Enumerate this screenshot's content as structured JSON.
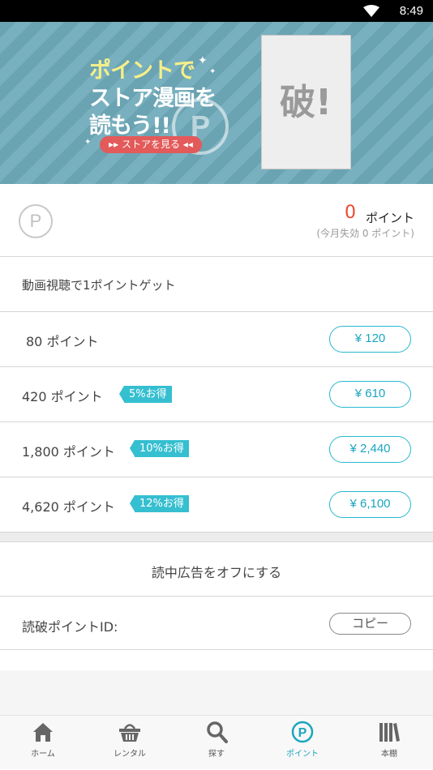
{
  "status_bar": {
    "time": "8:49"
  },
  "banner": {
    "line1": "ポイントで",
    "line2": "ストア漫画を",
    "line3": "読もう!!",
    "p_mark": "P",
    "store_button": "▸▸ ストアを見る ◂◂",
    "book_logo": "破!"
  },
  "points": {
    "logo": "P",
    "count": "0",
    "unit": "ポイント",
    "expire_note": "(今月失効 0 ポイント)"
  },
  "video_reward": {
    "label": "動画視聴で1ポイントゲット"
  },
  "packages": [
    {
      "points_label": "80 ポイント",
      "badge": "",
      "price": "¥ 120"
    },
    {
      "points_label": "420 ポイント",
      "badge": "5%お得",
      "price": "¥ 610"
    },
    {
      "points_label": "1,800 ポイント",
      "badge": "10%お得",
      "price": "¥ 2,440"
    },
    {
      "points_label": "4,620 ポイント",
      "badge": "12%お得",
      "price": "¥ 6,100"
    }
  ],
  "ad_off": {
    "label": "読中広告をオフにする"
  },
  "point_id": {
    "label": "読破ポイントID:",
    "copy_button": "コピー"
  },
  "tabs": [
    {
      "label": "ホーム",
      "icon": "home-icon",
      "active": false
    },
    {
      "label": "レンタル",
      "icon": "basket-icon",
      "active": false
    },
    {
      "label": "探す",
      "icon": "search-icon",
      "active": false
    },
    {
      "label": "ポイント",
      "icon": "point-icon",
      "active": true
    },
    {
      "label": "本棚",
      "icon": "bookshelf-icon",
      "active": false
    }
  ],
  "colors": {
    "accent": "#1aa6c0",
    "badge": "#35bfd0",
    "points_count": "#e84a2e",
    "store_button": "#e35a5a"
  }
}
